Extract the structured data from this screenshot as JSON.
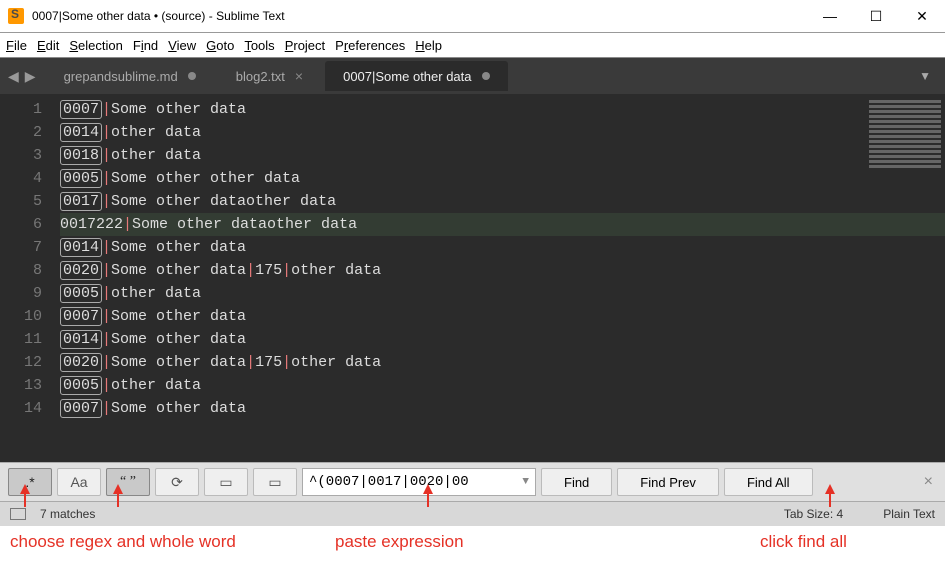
{
  "titlebar": {
    "title": "0007|Some other data • (source) - Sublime Text"
  },
  "menu": {
    "file": "File",
    "edit": "Edit",
    "selection": "Selection",
    "find": "Find",
    "view": "View",
    "goto": "Goto",
    "tools": "Tools",
    "project": "Project",
    "preferences": "Preferences",
    "help": "Help"
  },
  "tabs": [
    {
      "label": "grepandsublime.md",
      "dirty": true,
      "active": false
    },
    {
      "label": "blog2.txt",
      "dirty": false,
      "active": false
    },
    {
      "label": "0007|Some other data",
      "dirty": true,
      "active": true
    }
  ],
  "lines": [
    {
      "n": "1",
      "hi": "0007",
      "rest": "|Some other data"
    },
    {
      "n": "2",
      "hi": "0014",
      "rest": "|other data"
    },
    {
      "n": "3",
      "hi": "0018",
      "rest": "|other data"
    },
    {
      "n": "4",
      "hi": "0005",
      "rest": "|Some other other data"
    },
    {
      "n": "5",
      "hi": "0017",
      "rest": "|Some other dataother data"
    },
    {
      "n": "6",
      "raw": "0017222|Some other dataother data",
      "hl": true
    },
    {
      "n": "7",
      "hi": "0014",
      "rest": "|Some other data"
    },
    {
      "n": "8",
      "hi": "0020",
      "rest": "|Some other data|175|other data"
    },
    {
      "n": "9",
      "hi": "0005",
      "rest": "|other data"
    },
    {
      "n": "10",
      "hi": "0007",
      "rest": "|Some other data"
    },
    {
      "n": "11",
      "hi": "0014",
      "rest": "|Some other data"
    },
    {
      "n": "12",
      "hi": "0020",
      "rest": "|Some other data|175|other data"
    },
    {
      "n": "13",
      "hi": "0005",
      "rest": "|other data"
    },
    {
      "n": "14",
      "hi": "0007",
      "rest": "|Some other data"
    }
  ],
  "find": {
    "regex_on": true,
    "case_on": false,
    "whole_on": true,
    "wrap_on": false,
    "insel_on": false,
    "highlight_on": false,
    "input": "^(0007|0017|0020|00",
    "btn_find": "Find",
    "btn_prev": "Find Prev",
    "btn_all": "Find All"
  },
  "status": {
    "matches": "7 matches",
    "tabsize": "Tab Size: 4",
    "syntax": "Plain Text"
  },
  "annot": {
    "left": "choose regex and whole word",
    "mid": "paste expression",
    "right": "click find all"
  }
}
